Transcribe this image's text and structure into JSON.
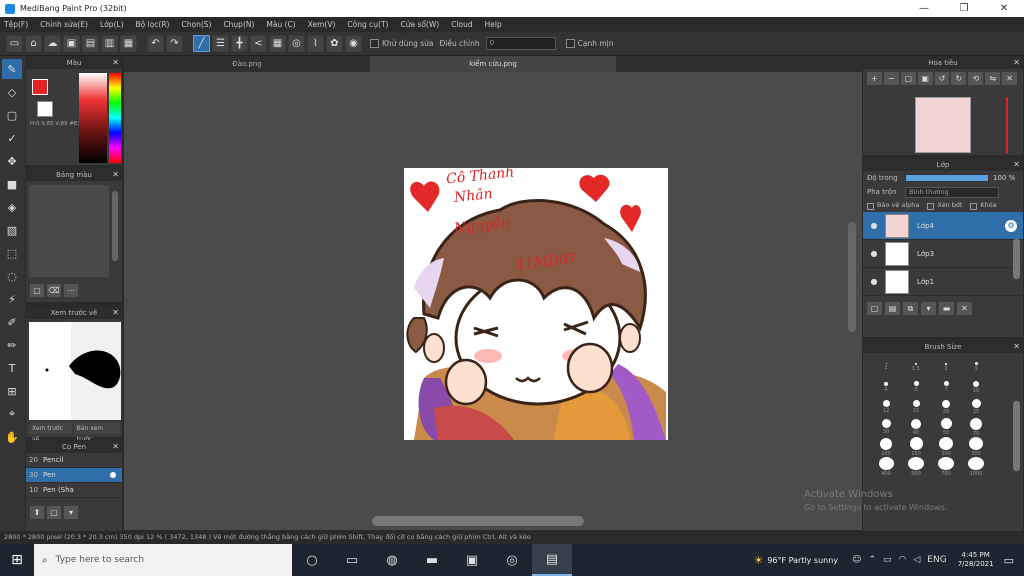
{
  "window": {
    "title": "MediBang Paint Pro (32bit)",
    "minimize": "—",
    "maximize": "❐",
    "close": "✕"
  },
  "menu": [
    "Tệp(F)",
    "Chỉnh sửa(E)",
    "Lớp(L)",
    "Bộ lọc(R)",
    "Chọn(S)",
    "Chụp(N)",
    "Màu (C)",
    "Xem(V)",
    "Công cụ(T)",
    "Cửa sổ(W)",
    "Cloud",
    "Help"
  ],
  "toolbar": {
    "stabilizer_label": "Khử dùng sửa",
    "correction_label": "Điều chỉnh",
    "correction_value": "0",
    "antialias_label": "Cạnh mịn"
  },
  "color_panel": {
    "title": "Màu",
    "info": "H:0 S:85 V:89 #E32222",
    "fg_color": "#e32222",
    "bg_color": "#ffffff"
  },
  "palette_panel": {
    "title": "Bảng màu"
  },
  "navigator_panel": {
    "title": "Xem trước vẽ",
    "tabs": [
      "Xem trước vẽ",
      "Bản xem trước"
    ]
  },
  "brush_panel": {
    "title": "Cọ Pen",
    "items": [
      {
        "size": "20",
        "name": "Pencil"
      },
      {
        "size": "30",
        "name": "Pen"
      },
      {
        "size": "10",
        "name": "Pen (Sha"
      }
    ]
  },
  "doc_tabs": [
    "Đào.png",
    "kiểm cừu.png",
    ""
  ],
  "artwork": {
    "handwriting_1": "Cô Thanh",
    "handwriting_2": "Nhân",
    "handwriting_3": "Nguyễn",
    "handwriting_4": "11MD07"
  },
  "navigator_right": {
    "title": "Hoa tiêu"
  },
  "layer_panel": {
    "title": "Lớp",
    "opacity_label": "Độ trong",
    "opacity_value": "100 %",
    "opacity": 1.0,
    "blend_label": "Pha trộn",
    "blend_value": "Bình thường",
    "checks": [
      "Bảo vệ alpha",
      "Xén bớt",
      "Khóa"
    ],
    "layers": [
      {
        "name": "Lớp4"
      },
      {
        "name": "Lớp3"
      },
      {
        "name": "Lớp1"
      }
    ]
  },
  "brush_size_panel": {
    "title": "Brush Size",
    "sizes": [
      "1",
      "1.5",
      "2",
      "3",
      "4",
      "5",
      "7",
      "10",
      "12",
      "15",
      "20",
      "25",
      "30",
      "40",
      "50",
      "70",
      "100",
      "150",
      "200",
      "300",
      "400",
      "500",
      "700",
      "1000"
    ]
  },
  "watermark": {
    "line1": "Activate Windows",
    "line2": "Go to Settings to activate Windows."
  },
  "statusbar": {
    "text": "2800 * 2800 pixel  (20.3 * 20.3 cm)  350 dpi  12 %  ( 3472, 1348 )  Vẽ một đường thẳng bằng cách giữ phím Shift, Thay đổi cỡ cọ bằng cách giữ phím Ctrl, Alt và kéo"
  },
  "taskbar": {
    "search_placeholder": "Type here to search",
    "weather": "96°F  Partly sunny",
    "lang": "ENG",
    "time": "4:45 PM",
    "date": "7/28/2021"
  }
}
